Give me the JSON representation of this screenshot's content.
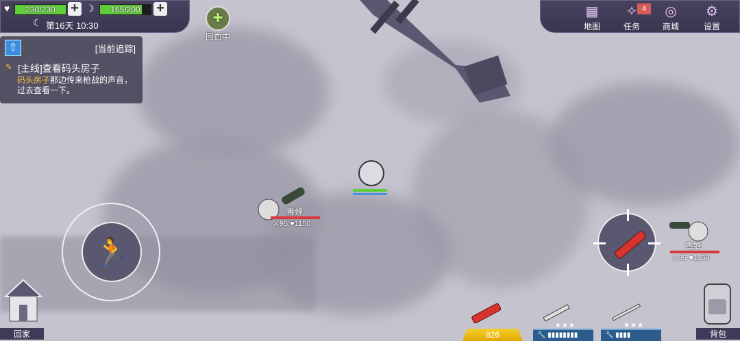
{
  "hud": {
    "health_value": "230/230",
    "health_fraction": 1.0,
    "hunger_value": "165/200",
    "hunger_fraction": 0.825,
    "day_time": "第16天 10:30",
    "regen_label": "回血中"
  },
  "quest": {
    "header": "[当前追踪]",
    "title": "[主线]查看码头房子",
    "desc_highlight": "码头房子",
    "desc_rest": "那边传来枪战的声音，过去查看一下。"
  },
  "menu": {
    "items": [
      {
        "label": "地图",
        "icon": "map-icon"
      },
      {
        "label": "任务",
        "icon": "quest-icon",
        "badge": "4"
      },
      {
        "label": "商城",
        "icon": "shop-coins-icon"
      },
      {
        "label": "设置",
        "icon": "gear-icon"
      }
    ]
  },
  "enemies": [
    {
      "name": "毒蜂",
      "atk": "95",
      "hp": "1150"
    },
    {
      "name": "毒蜂",
      "atk": "95",
      "hp": "1150"
    }
  ],
  "bottom": {
    "home_label": "回家",
    "bag_label": "背包",
    "dynamite_count": "826",
    "weapon_stars": "★★★"
  },
  "colors": {
    "hud_bg": "#3a3550",
    "health_green": "#5ecf3a",
    "gold_slot": "#f6cf2b",
    "blue_slot": "#2b5c8c",
    "enemy_hp": "#d93b3b"
  }
}
